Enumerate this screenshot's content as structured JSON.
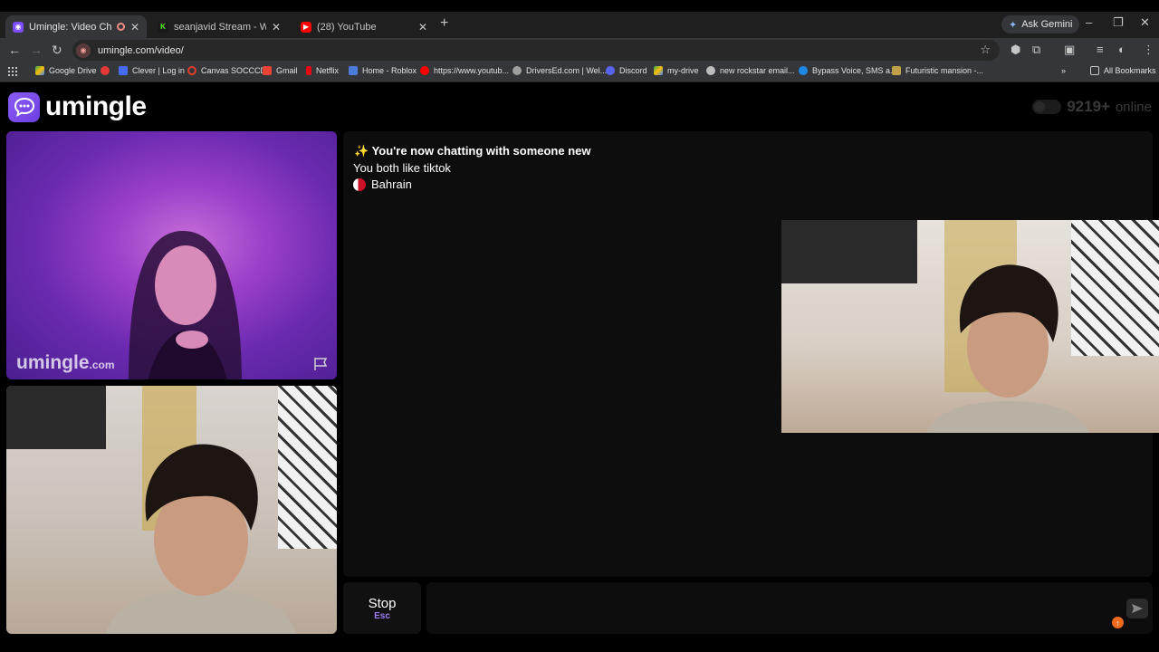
{
  "browser": {
    "tabs": [
      {
        "title": "Umingle: Video Chat with S",
        "active": true,
        "favicon_color": "#7c4dff"
      },
      {
        "title": "seanjavid Stream - Watch Live o",
        "active": false,
        "favicon_color": "#53fc18"
      },
      {
        "title": "(28) YouTube",
        "active": false,
        "favicon_color": "#ff0000"
      }
    ],
    "ask_gemini": "Ask Gemini",
    "url": "umingle.com/video/",
    "bookmarks": [
      "Google Drive",
      "Clever | Log in",
      "Canvas SOCCCD",
      "Gmail",
      "Netflix",
      "Home - Roblox",
      "https://www.youtub...",
      "DriversEd.com | Wel...",
      "Discord",
      "my-drive",
      "new rockstar email...",
      "Bypass Voice, SMS a...",
      "Futuristic mansion -..."
    ],
    "all_bookmarks": "All Bookmarks"
  },
  "site": {
    "logo_text": "umingle",
    "online_count": "9219+",
    "online_label": "online",
    "brand_color": "#7c4dff"
  },
  "video": {
    "watermark_main": "umingle",
    "watermark_suffix": ".com"
  },
  "chat": {
    "sparkle": "✨",
    "message_new": "You're now chatting with someone new",
    "message_interest": "You both like tiktok",
    "country": "Bahrain"
  },
  "controls": {
    "stop_label": "Stop",
    "stop_key": "Esc",
    "input_placeholder": ""
  }
}
